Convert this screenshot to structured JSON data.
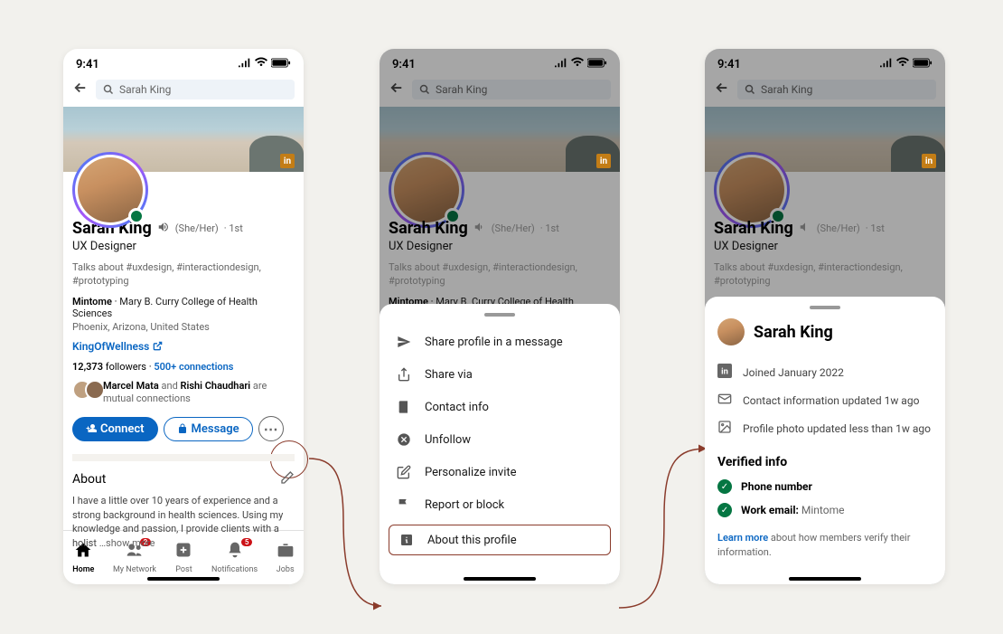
{
  "status": {
    "time": "9:41"
  },
  "search": {
    "value": "Sarah King"
  },
  "profile": {
    "name": "Sarah King",
    "pronouns": "(She/Her)",
    "degree": "1st",
    "headline": "UX Designer",
    "talks_about": "Talks about #uxdesign, #interactiondesign, #prototyping",
    "employer": "Mintome",
    "school": "Mary B. Curry College of Health Sciences",
    "location": "Phoenix, Arizona, United States",
    "website": "KingOfWellness",
    "followers_count": "12,373",
    "followers_label": "followers",
    "connections": "500+ connections",
    "mutual_1": "Marcel Mata",
    "mutual_and": " and ",
    "mutual_2": "Rishi Chaudhari",
    "mutual_tail": " are mutual connections",
    "connect_label": "Connect",
    "message_label": "Message",
    "about_heading": "About",
    "about_text": "I have a little over 10 years of experience and a strong background in health sciences. Using my knowledge and passion, I provide clients with a holist",
    "show_more": "…show more"
  },
  "nav": {
    "home": "Home",
    "network": "My Network",
    "network_badge": "2",
    "post": "Post",
    "notifications": "Notifications",
    "notif_badge": "5",
    "jobs": "Jobs"
  },
  "sheet_menu": {
    "share_message": "Share profile in a message",
    "share_via": "Share via",
    "contact_info": "Contact info",
    "unfollow": "Unfollow",
    "personalize": "Personalize invite",
    "report": "Report or block",
    "about_profile": "About this profile"
  },
  "about_sheet": {
    "name": "Sarah King",
    "joined": "Joined January 2022",
    "contact_updated": "Contact information updated 1w ago",
    "photo_updated": "Profile photo updated less than 1w ago",
    "verified_heading": "Verified info",
    "phone": "Phone number",
    "work_email_label": "Work email:",
    "work_email_value": "Mintome",
    "learn_more": "Learn more",
    "learn_more_tail": " about how members verify their information."
  }
}
